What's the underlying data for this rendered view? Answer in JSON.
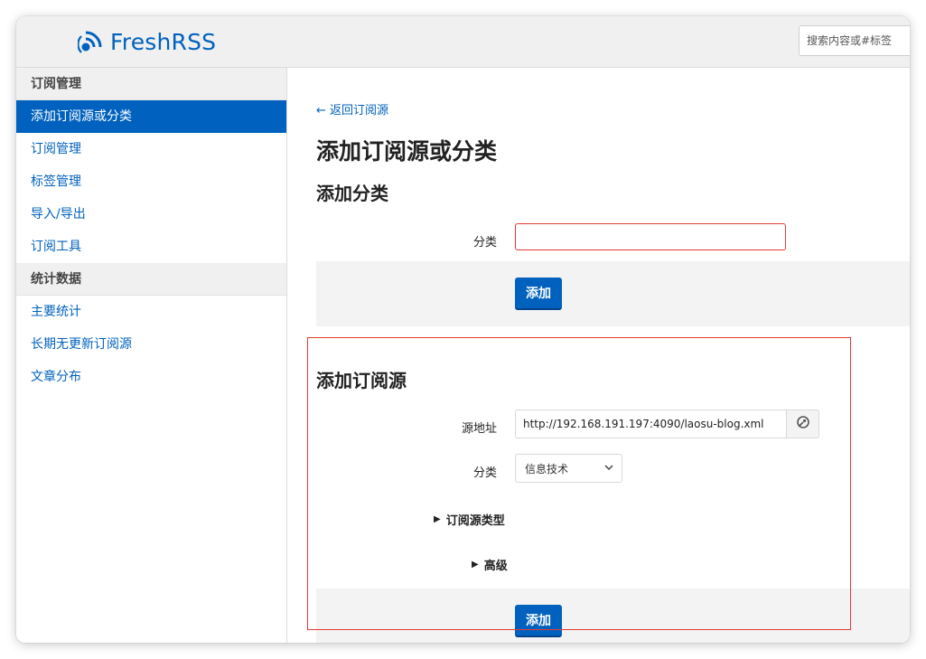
{
  "app": {
    "title": "FreshRSS",
    "logo_icon": "rss-feed-icon",
    "accent": "#0062be",
    "invalid_color": "#e53935"
  },
  "search": {
    "placeholder": "搜索内容或#标签",
    "value": ""
  },
  "sidebar": {
    "group1": "订阅管理",
    "items1": [
      {
        "label": "添加订阅源或分类",
        "active": true
      },
      {
        "label": "订阅管理"
      },
      {
        "label": "标签管理"
      },
      {
        "label": "导入/导出"
      },
      {
        "label": "订阅工具"
      }
    ],
    "group2": "统计数据",
    "items2": [
      {
        "label": "主要统计"
      },
      {
        "label": "长期无更新订阅源"
      },
      {
        "label": "文章分布"
      }
    ]
  },
  "main": {
    "back_link": "← 返回订阅源",
    "title": "添加订阅源或分类",
    "category_section": {
      "heading": "添加分类",
      "field_label": "分类",
      "field_value": "",
      "submit": "添加"
    },
    "feed_section": {
      "heading": "添加订阅源",
      "url_label": "源地址",
      "url_value": "http://192.168.191.197:4090/laosu-blog.xml",
      "url_button_icon": "feed-check-icon",
      "category_label": "分类",
      "category_selected": "信息技术",
      "feed_type_toggle": "订阅源类型",
      "advanced_toggle": "高级",
      "submit": "添加"
    }
  }
}
